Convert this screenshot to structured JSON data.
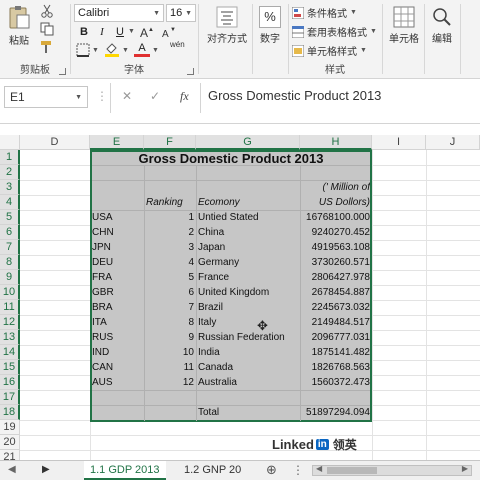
{
  "ribbon": {
    "clipboard": {
      "paste_label": "粘贴",
      "group_label": "剪贴板"
    },
    "font": {
      "name": "Calibri",
      "size": "16",
      "bold_label": "B",
      "italic_label": "I",
      "underline_label": "U",
      "group_label": "字体",
      "font_color_glyph": "A",
      "wen_glyph": "wén"
    },
    "alignment": {
      "label": "对齐方式"
    },
    "number": {
      "label": "数字",
      "percent_glyph": "%"
    },
    "styles": {
      "conditional_format": "条件格式",
      "table_format": "套用表格格式",
      "cell_styles": "单元格样式",
      "group_label": "样式"
    },
    "cells": {
      "label": "单元格"
    },
    "editing": {
      "label": "编辑"
    }
  },
  "formula_bar": {
    "name_box": "E1",
    "cancel_glyph": "✕",
    "enter_glyph": "✓",
    "fx_glyph": "fx",
    "content": "Gross Domestic Product 2013"
  },
  "grid": {
    "columns": [
      "D",
      "E",
      "F",
      "G",
      "H",
      "I",
      "J"
    ],
    "rows": [
      "1",
      "2",
      "3",
      "4",
      "5",
      "6",
      "7",
      "8",
      "9",
      "10",
      "11",
      "12",
      "13",
      "14",
      "15",
      "16",
      "17",
      "18",
      "19",
      "20",
      "21"
    ],
    "title": "Gross Domestic Product 2013",
    "header_million": "(' Million of",
    "header_usd": "US Dollors)",
    "header_ranking": "Ranking",
    "header_economy": "Ecomony",
    "data": [
      {
        "code": "USA",
        "rank": "1",
        "country": "Untied Stated",
        "gdp": "16768100.000"
      },
      {
        "code": "CHN",
        "rank": "2",
        "country": "China",
        "gdp": "9240270.452"
      },
      {
        "code": "JPN",
        "rank": "3",
        "country": "Japan",
        "gdp": "4919563.108"
      },
      {
        "code": "DEU",
        "rank": "4",
        "country": "Germany",
        "gdp": "3730260.571"
      },
      {
        "code": "FRA",
        "rank": "5",
        "country": "France",
        "gdp": "2806427.978"
      },
      {
        "code": "GBR",
        "rank": "6",
        "country": "United Kingdom",
        "gdp": "2678454.887"
      },
      {
        "code": "BRA",
        "rank": "7",
        "country": "Brazil",
        "gdp": "2245673.032"
      },
      {
        "code": "ITA",
        "rank": "8",
        "country": "Italy",
        "gdp": "2149484.517"
      },
      {
        "code": "RUS",
        "rank": "9",
        "country": "Russian Federation",
        "gdp": "2096777.031"
      },
      {
        "code": "IND",
        "rank": "10",
        "country": "India",
        "gdp": "1875141.482"
      },
      {
        "code": "CAN",
        "rank": "11",
        "country": "Canada",
        "gdp": "1826768.563"
      },
      {
        "code": "AUS",
        "rank": "12",
        "country": "Australia",
        "gdp": "1560372.473"
      }
    ],
    "total_label": "Total",
    "total_value": "51897294.094"
  },
  "branding": {
    "linked": "Linked",
    "in": "in",
    "cn": "领英"
  },
  "tabs": {
    "sheet1": "1.1 GDP 2013",
    "sheet2": "1.2 GNP 20",
    "add_glyph": "⊕",
    "options_glyph": "⋮"
  }
}
